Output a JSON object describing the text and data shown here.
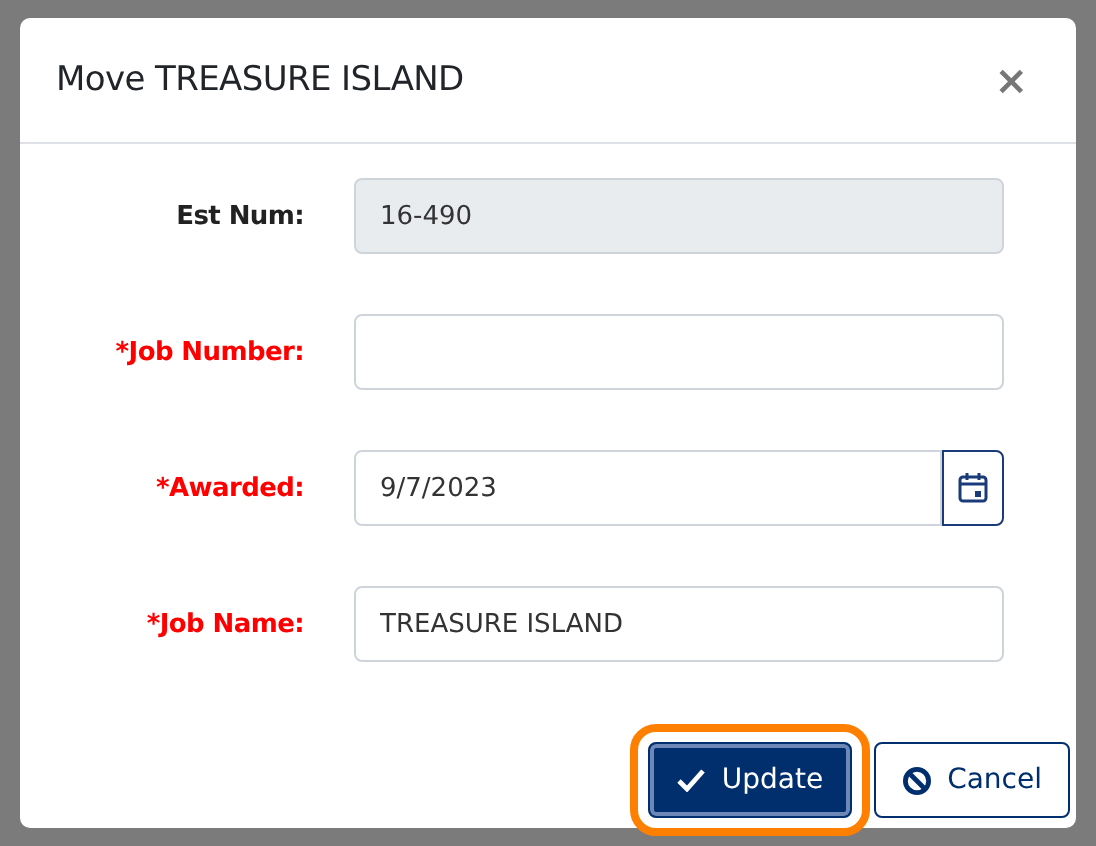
{
  "dialog": {
    "title": "Move TREASURE ISLAND",
    "close": "×"
  },
  "fields": [
    {
      "label": "Est Num:",
      "required": false,
      "kind": "readonly",
      "value": "16-490"
    },
    {
      "label": "*Job Number:",
      "required": true,
      "kind": "text"
    },
    {
      "label": "*Awarded:",
      "required": true,
      "kind": "date",
      "value": "9/7/2023"
    },
    {
      "label": "*Job Name:",
      "required": true,
      "kind": "text",
      "value": "TREASURE ISLAND"
    }
  ],
  "buttons": [
    {
      "label": "Update",
      "kind": "primary",
      "focused": true
    },
    {
      "label": "Cancel",
      "kind": "cancel",
      "focused": false
    }
  ]
}
